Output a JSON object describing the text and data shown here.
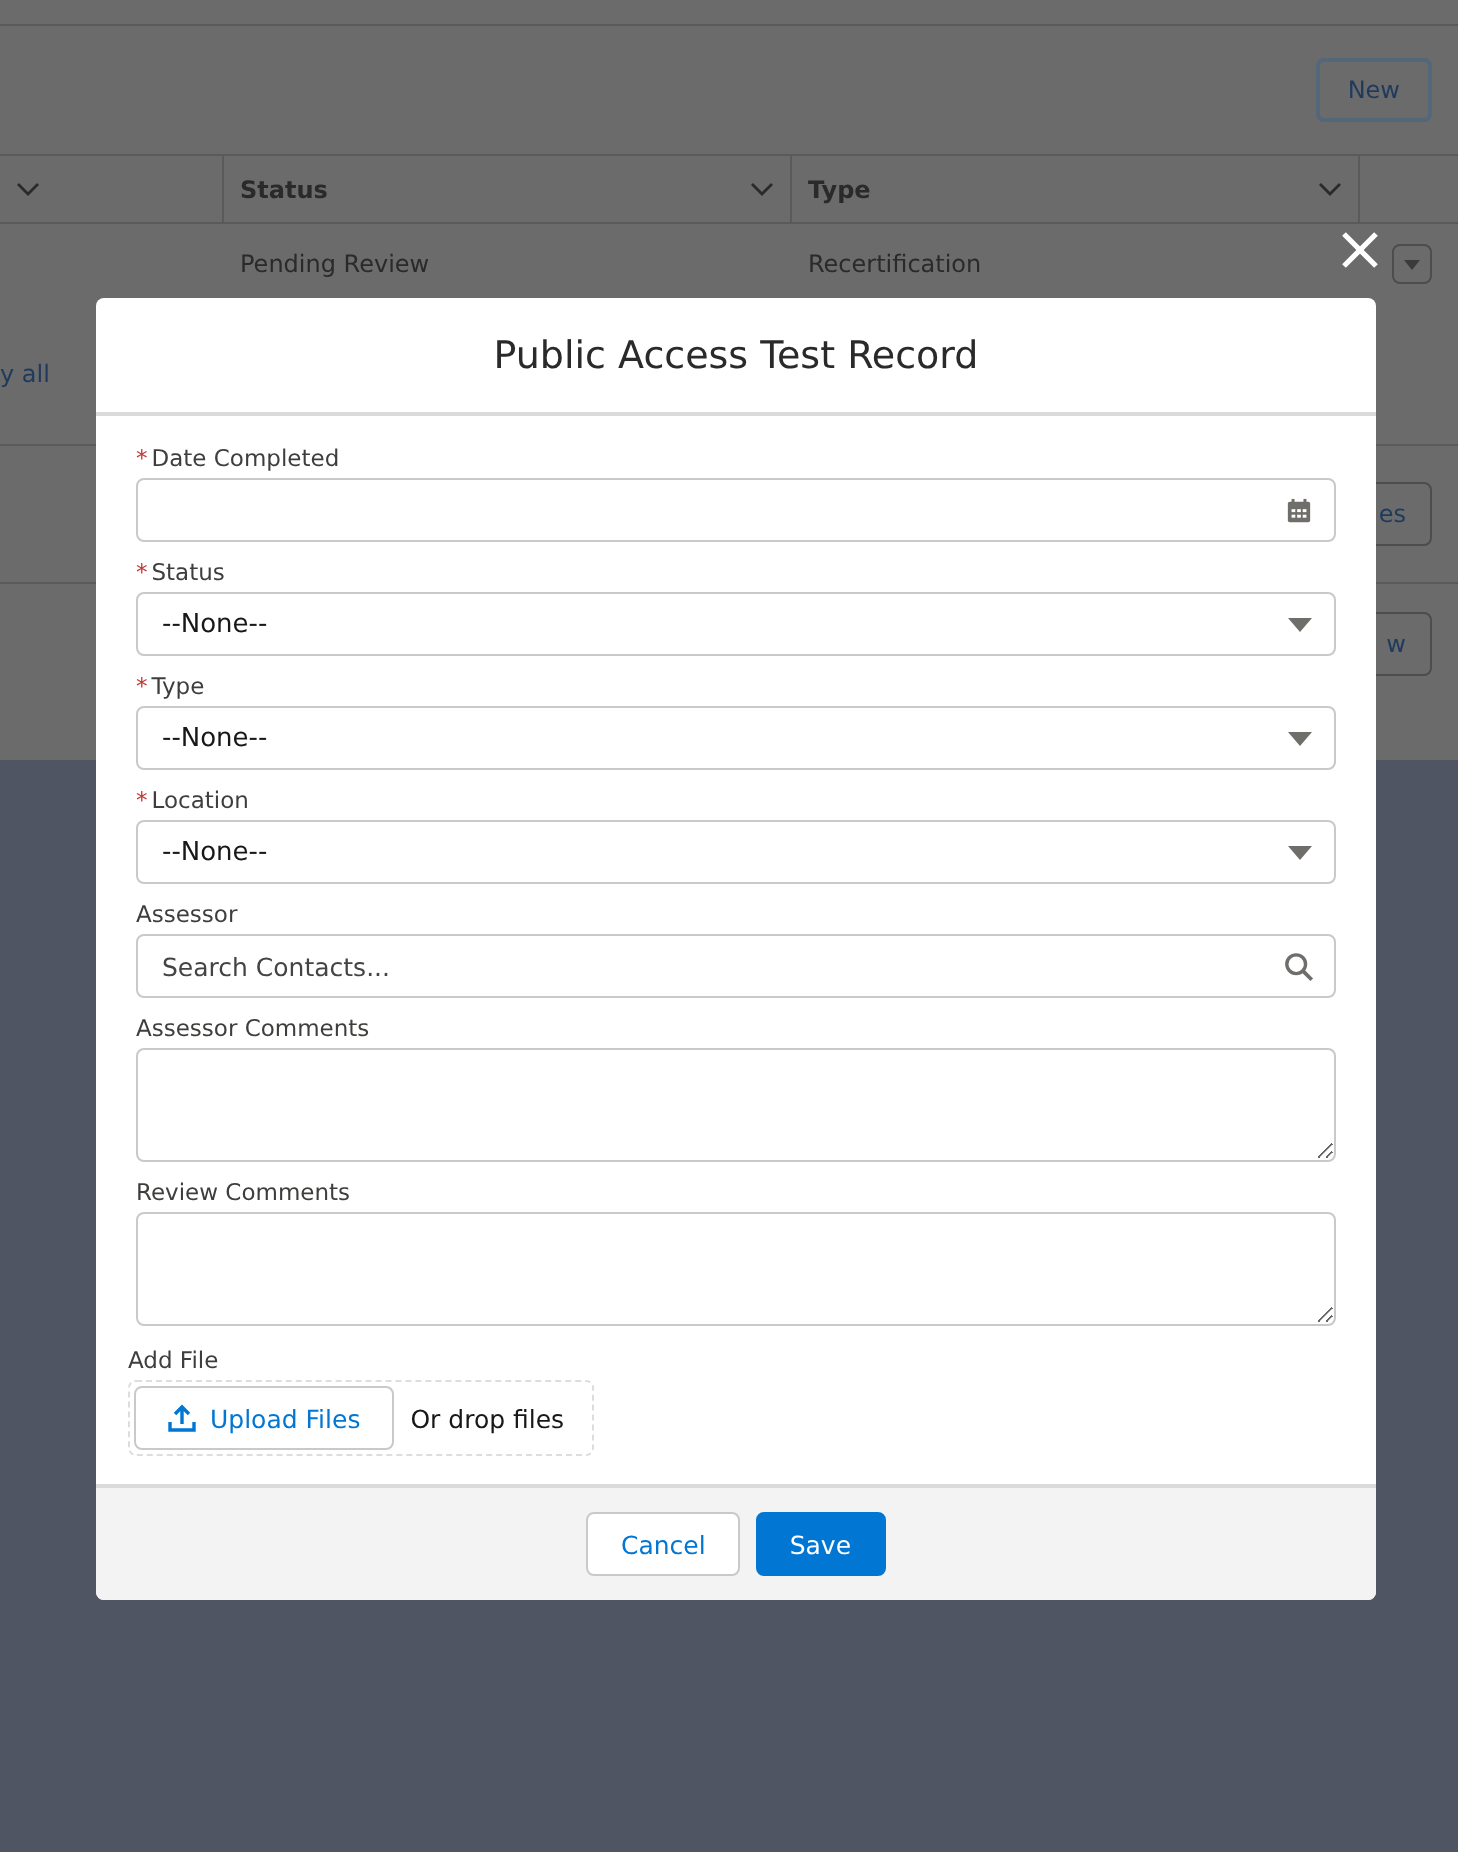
{
  "background": {
    "new_button": "New",
    "table": {
      "columns": [
        {
          "label": "Status"
        },
        {
          "label": "Type"
        }
      ],
      "row": [
        "Pending Review",
        "Recertification"
      ]
    },
    "view_all_link": "y all",
    "card_button_1": "es",
    "card_button_2": "w"
  },
  "modal": {
    "title": "Public Access Test Record",
    "fields": [
      {
        "kind": "date",
        "label": "Date Completed",
        "required_mark": "*"
      },
      {
        "kind": "select",
        "label": "Status",
        "required_mark": "*",
        "value": "--None--"
      },
      {
        "kind": "select",
        "label": "Type",
        "required_mark": "*",
        "value": "--None--"
      },
      {
        "kind": "select",
        "label": "Location",
        "required_mark": "*",
        "value": "--None--"
      },
      {
        "kind": "lookup",
        "label": "Assessor",
        "placeholder": "Search Contacts..."
      },
      {
        "kind": "textarea",
        "label": "Assessor Comments"
      },
      {
        "kind": "textarea",
        "label": "Review Comments"
      }
    ],
    "file": {
      "label": "Add File",
      "upload_button": "Upload Files",
      "drop_text": "Or drop files"
    },
    "buttons": {
      "cancel": "Cancel",
      "save": "Save"
    }
  }
}
